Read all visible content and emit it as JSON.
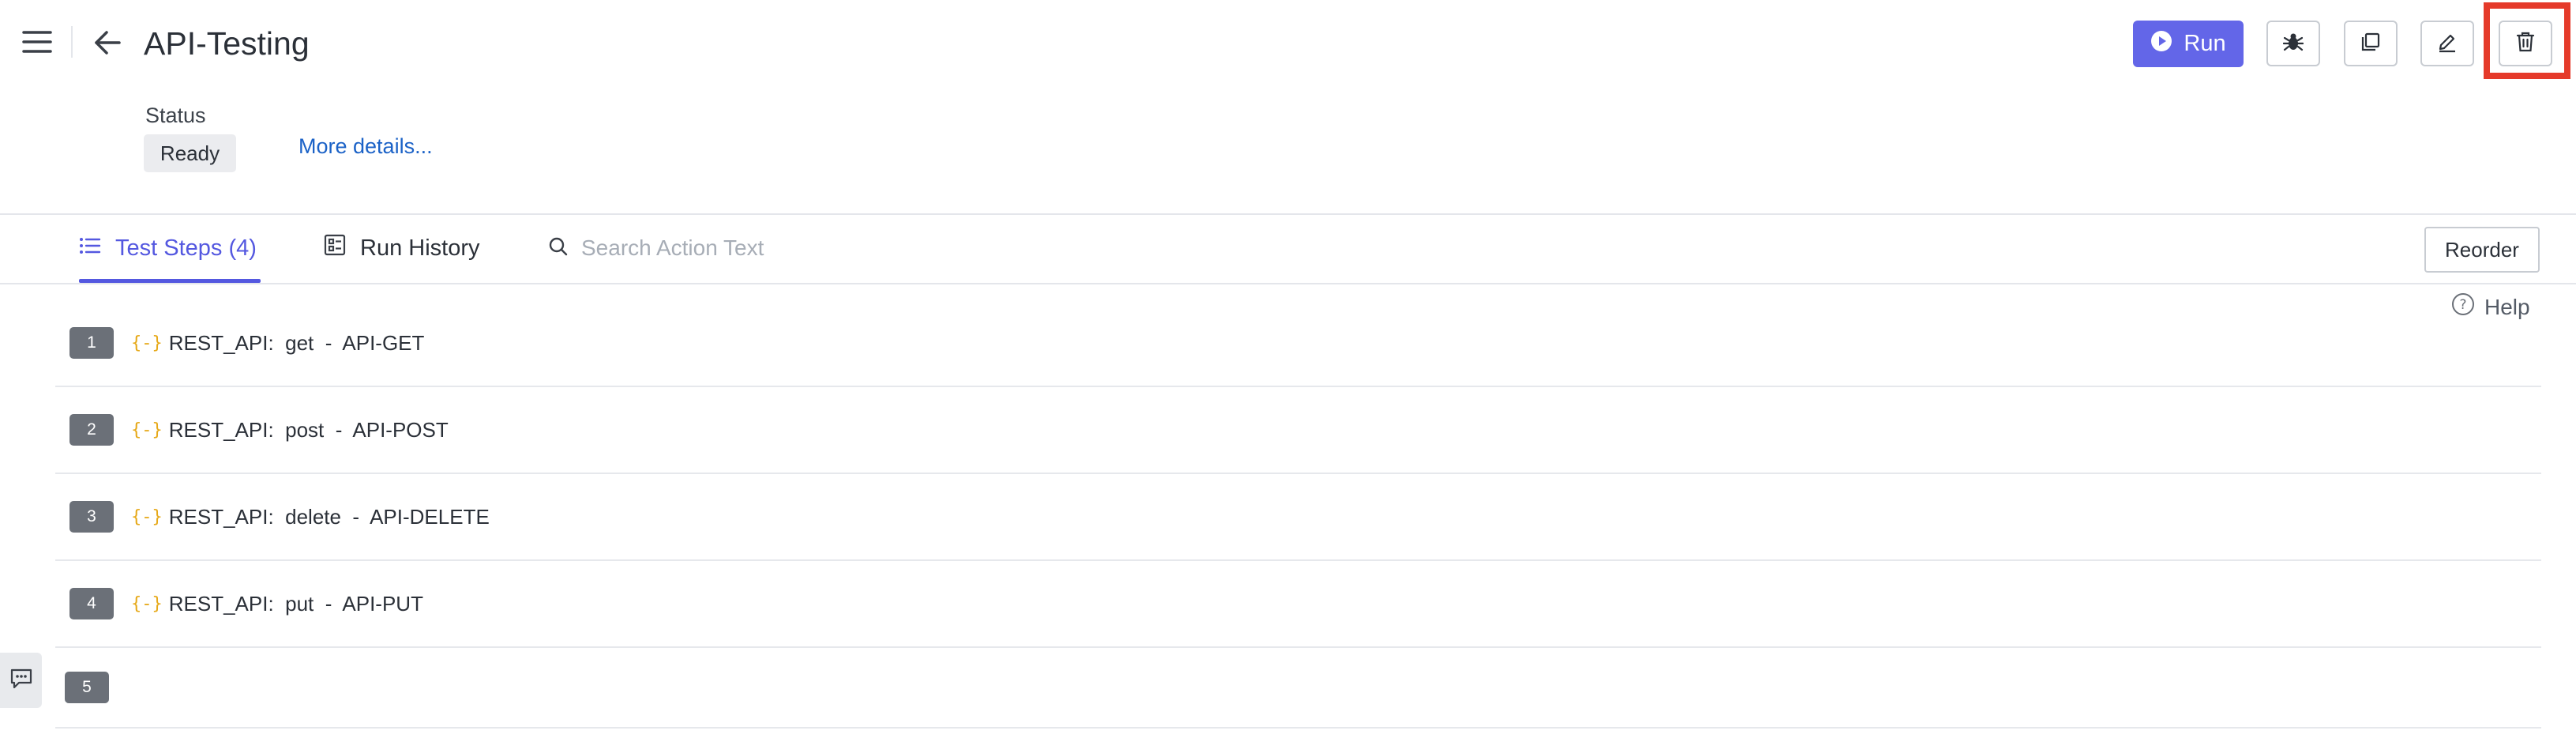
{
  "header": {
    "title": "API-Testing",
    "run_label": "Run"
  },
  "status": {
    "label": "Status",
    "value": "Ready",
    "more_details": "More details..."
  },
  "tabs": [
    {
      "label": "Test Steps (4)",
      "active": true
    },
    {
      "label": "Run History",
      "active": false
    }
  ],
  "search": {
    "placeholder": "Search Action Text",
    "value": ""
  },
  "reorder_label": "Reorder",
  "help_label": "Help",
  "steps": [
    {
      "num": "1",
      "text": "REST_API:  get  -  API-GET"
    },
    {
      "num": "2",
      "text": "REST_API:  post  -  API-POST"
    },
    {
      "num": "3",
      "text": "REST_API:  delete  -  API-DELETE"
    },
    {
      "num": "4",
      "text": "REST_API:  put  -  API-PUT"
    },
    {
      "num": "5",
      "text": ""
    }
  ],
  "step_icon_glyph": "{-}",
  "colors": {
    "accent": "#5458e0",
    "run_button": "#6366e8",
    "highlight": "#e53a2a",
    "link": "#1b62c7",
    "step_icon": "#e6a817"
  }
}
